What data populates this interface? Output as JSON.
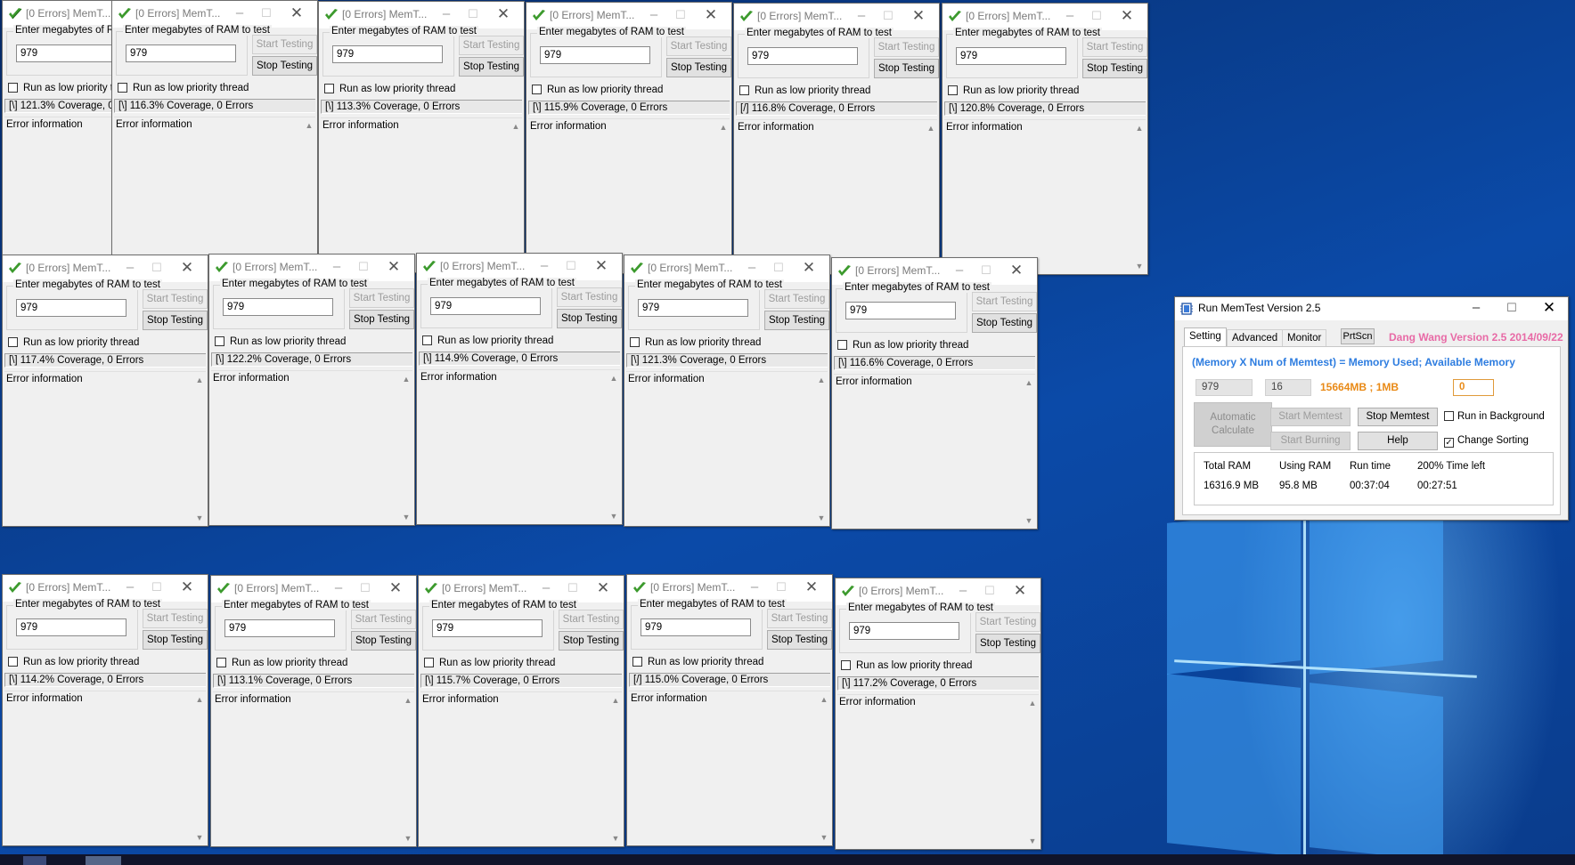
{
  "window_title": "[0 Errors] MemT...",
  "ram_label": "Enter megabytes of RAM to test",
  "ram_value": "979",
  "start_label": "Start Testing",
  "stop_label": "Stop Testing",
  "low_priority_label": "Run as low priority thread",
  "error_info_label": "Error information",
  "icon": "memtest-check-icon",
  "coverages": [
    "[\\]  121.3% Coverage, 0 Errors",
    "[\\]  116.3% Coverage, 0 Errors",
    "[\\]  113.3% Coverage, 0 Errors",
    "[\\]  115.9% Coverage, 0 Errors",
    "[/]  116.8% Coverage, 0 Errors",
    "[\\]  120.8% Coverage, 0 Errors",
    "[\\]  117.4% Coverage, 0 Errors",
    "[\\]  122.2% Coverage, 0 Errors",
    "[\\]  114.9% Coverage, 0 Errors",
    "[\\]  121.3% Coverage, 0 Errors",
    "[\\]  116.6% Coverage, 0 Errors",
    "[\\]  114.2% Coverage, 0 Errors",
    "[\\]  113.1% Coverage, 0 Errors",
    "[\\]  115.7% Coverage, 0 Errors",
    "[/]  115.0% Coverage, 0 Errors",
    "[\\]  117.2% Coverage, 0 Errors"
  ],
  "main": {
    "title": "Run MemTest Version 2.5",
    "tabs": [
      "Setting",
      "Advanced",
      "Monitor"
    ],
    "prtscn_label": "PrtScn",
    "version_text": "Dang Wang Version 2.5 2014/09/22",
    "formula": "(Memory  X Num of Memtest) = Memory Used; Available Memory",
    "ram_value": "979",
    "count_value": "16",
    "memory_text": "15664MB ; 1MB",
    "zero_value": "0",
    "auto_label": "Automatic Calculate",
    "start_memtest": "Start Memtest",
    "stop_memtest": "Stop Memtest",
    "start_burning": "Start Burning",
    "help": "Help",
    "run_background": "Run in Background",
    "change_sorting": "Change Sorting",
    "run_background_checked": false,
    "change_sorting_checked": true,
    "stats_headers": [
      "Total RAM",
      "Using RAM",
      "Run time",
      "200% Time left"
    ],
    "stats_values": [
      "16316.9 MB",
      "95.8 MB",
      "00:37:04",
      "00:27:51"
    ],
    "colors": {
      "formula": "#2e7de0",
      "version": "#e86aa6",
      "memory": "#e98a17"
    }
  }
}
